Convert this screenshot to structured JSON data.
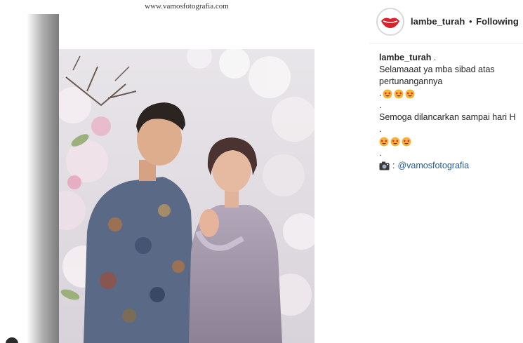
{
  "photo": {
    "watermark": "www.vamosfotografia.com"
  },
  "post": {
    "username": "lambe_turah",
    "separator": "•",
    "follow_status": "Following",
    "caption": {
      "username": "lambe_turah",
      "after_username": " .",
      "line1": "Selamaaat ya mba sibad atas",
      "line2": "pertunangannya",
      "line3_prefix": ".",
      "line4": ".",
      "line5": "Semoga dilancarkan sampai hari H",
      "line6": ".",
      "line8": ".",
      "credit_prefix": ":",
      "credit_handle": "@vamosfotografia"
    },
    "emoji_row_1": [
      "heart-eyes",
      "heart-eyes",
      "heart-eyes"
    ],
    "emoji_row_2": [
      "heart-eyes",
      "heart-eyes",
      "heart-eyes"
    ],
    "credit_icon": "camera-icon"
  },
  "colors": {
    "link": "#1d5d9b",
    "avatar_lips": "#d8232a"
  }
}
